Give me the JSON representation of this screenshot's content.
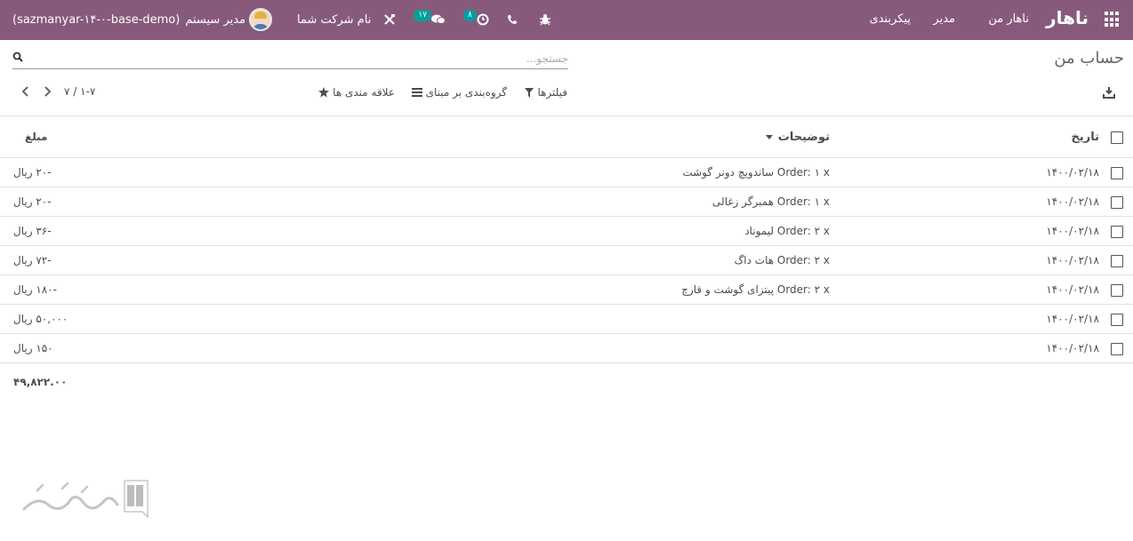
{
  "navbar": {
    "brand": "ناهار",
    "menu": [
      "ناهار من",
      "مدیر",
      "پیکربندی"
    ],
    "company": "نام شرکت شما",
    "messages_count": "۱۷",
    "activities_count": "۸",
    "user": "مدیر سیستم",
    "database": "(sazmanyar-۱۴-۰-base-demo)"
  },
  "control_panel": {
    "breadcrumb": "حساب من",
    "search_placeholder": "جستجو...",
    "filters_label": "فیلترها",
    "groupby_label": "گروه‌بندی بر مبنای",
    "favorites_label": "علاقه مندی ها",
    "pager_value": "۱-۷",
    "pager_separator": "/",
    "pager_total": "۷"
  },
  "table": {
    "headers": {
      "date": "تاریخ",
      "description": "توضیحات",
      "amount": "مبلغ"
    },
    "rows": [
      {
        "date": "۱۴۰۰/۰۲/۱۸",
        "description": "Order: ۱ x ساندویچ دونر گوشت",
        "amount": "-۲۰ ریال"
      },
      {
        "date": "۱۴۰۰/۰۲/۱۸",
        "description": "Order: ۱ x همبرگر زغالی",
        "amount": "-۲۰ ریال"
      },
      {
        "date": "۱۴۰۰/۰۲/۱۸",
        "description": "Order: ۲ x لیموناد",
        "amount": "-۳۶ ریال"
      },
      {
        "date": "۱۴۰۰/۰۲/۱۸",
        "description": "Order: ۲ x هات داگ",
        "amount": "-۷۲ ریال"
      },
      {
        "date": "۱۴۰۰/۰۲/۱۸",
        "description": "Order: ۲ x پیتزای گوشت و قارچ",
        "amount": "-۱۸۰ ریال"
      },
      {
        "date": "۱۴۰۰/۰۲/۱۸",
        "description": "",
        "amount": "۵۰,۰۰۰ ریال"
      },
      {
        "date": "۱۴۰۰/۰۲/۱۸",
        "description": "",
        "amount": "۱۵۰ ریال"
      }
    ],
    "total": "۴۹,۸۲۲.۰۰"
  },
  "icons": {
    "apps": "apps-grid-icon",
    "bug": "bug-icon",
    "phone": "phone-icon",
    "activity": "clock-icon",
    "chat": "chat-icon",
    "tools": "tools-icon",
    "search": "search-icon",
    "download": "download-icon",
    "filter": "filter-icon",
    "groupby": "list-icon",
    "favorite": "star-icon"
  },
  "colors": {
    "navbar": "#875a7b",
    "badge": "#00a09d"
  }
}
